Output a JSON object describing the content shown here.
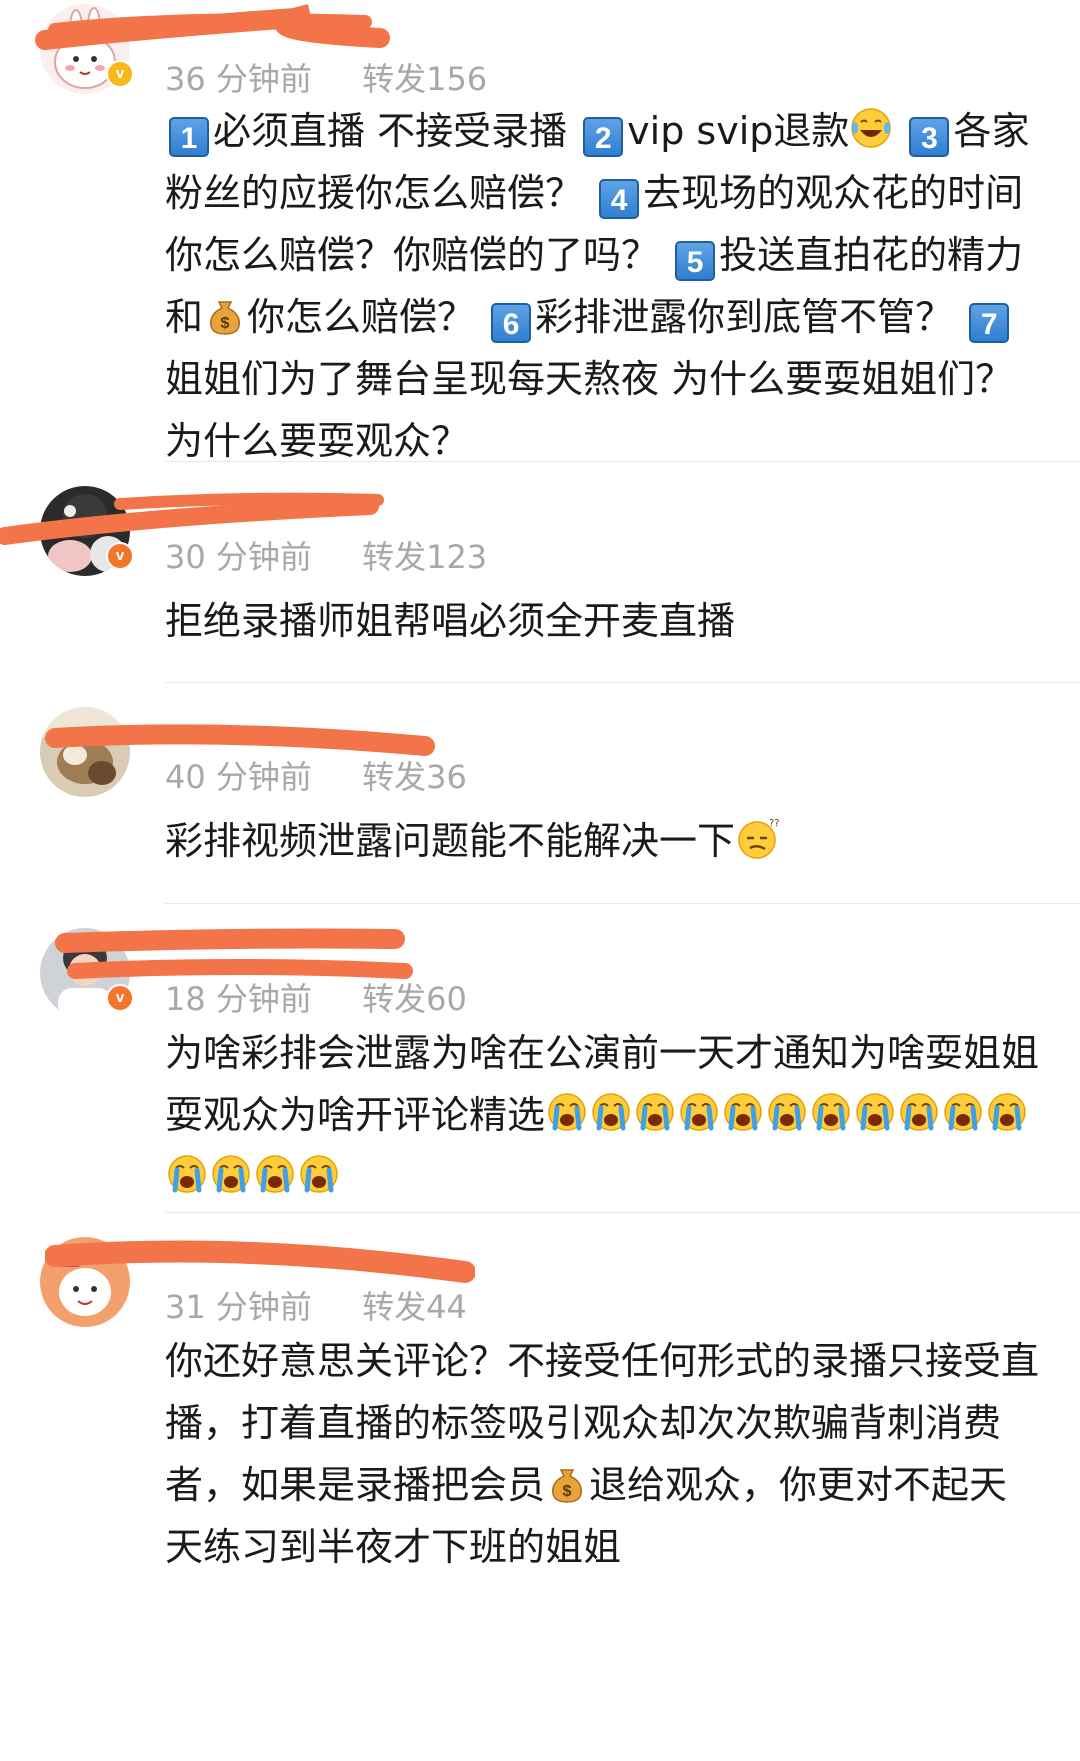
{
  "colors": {
    "redaction": "#f37448",
    "meta": "#a8a8a8",
    "text": "#1a1a1a",
    "badge_gold": "#f6b81b",
    "badge_orange": "#f2752b"
  },
  "comments": [
    {
      "time": "36 分钟前",
      "reposts": "转发156",
      "badge": "v",
      "segments": [
        {
          "t": "k",
          "v": "1"
        },
        {
          "t": "s",
          "v": "必须直播 不接受录播 "
        },
        {
          "t": "k",
          "v": "2"
        },
        {
          "t": "s",
          "v": "vip svip退款"
        },
        {
          "t": "e",
          "v": "laugh-cry-emoji"
        },
        {
          "t": "s",
          "v": " "
        },
        {
          "t": "k",
          "v": "3"
        },
        {
          "t": "s",
          "v": "各家粉丝的应援你怎么赔偿？ "
        },
        {
          "t": "k",
          "v": "4"
        },
        {
          "t": "s",
          "v": "去现场的观众花的时间你怎么赔偿？你赔偿的了吗？ "
        },
        {
          "t": "k",
          "v": "5"
        },
        {
          "t": "s",
          "v": "投送直拍花的精力和"
        },
        {
          "t": "e",
          "v": "money-bag-emoji"
        },
        {
          "t": "s",
          "v": "你怎么赔偿？ "
        },
        {
          "t": "k",
          "v": "6"
        },
        {
          "t": "s",
          "v": "彩排泄露你到底管不管？ "
        },
        {
          "t": "k",
          "v": "7"
        },
        {
          "t": "s",
          "v": "姐姐们为了舞台呈现每天熬夜 为什么要耍姐姐们？为什么要耍观众？"
        }
      ]
    },
    {
      "time": "30 分钟前",
      "reposts": "转发123",
      "badge": "v",
      "segments": [
        {
          "t": "s",
          "v": "拒绝录播师姐帮唱必须全开麦直播"
        }
      ]
    },
    {
      "time": "40 分钟前",
      "reposts": "转发36",
      "badge": "",
      "segments": [
        {
          "t": "s",
          "v": "彩排视频泄露问题能不能解决一下"
        },
        {
          "t": "e",
          "v": "confused-emoji"
        }
      ]
    },
    {
      "time": "18 分钟前",
      "reposts": "转发60",
      "badge": "v",
      "segments": [
        {
          "t": "s",
          "v": "为啥彩排会泄露为啥在公演前一天才通知为啥耍姐姐耍观众为啥开评论精选"
        },
        {
          "t": "e",
          "v": "crying-emoji"
        },
        {
          "t": "e",
          "v": "crying-emoji"
        },
        {
          "t": "e",
          "v": "crying-emoji"
        },
        {
          "t": "e",
          "v": "crying-emoji"
        },
        {
          "t": "e",
          "v": "crying-emoji"
        },
        {
          "t": "e",
          "v": "crying-emoji"
        },
        {
          "t": "e",
          "v": "crying-emoji"
        },
        {
          "t": "e",
          "v": "crying-emoji"
        },
        {
          "t": "e",
          "v": "crying-emoji"
        },
        {
          "t": "e",
          "v": "crying-emoji"
        },
        {
          "t": "e",
          "v": "crying-emoji"
        },
        {
          "t": "e",
          "v": "crying-emoji"
        },
        {
          "t": "e",
          "v": "crying-emoji"
        },
        {
          "t": "e",
          "v": "crying-emoji"
        },
        {
          "t": "e",
          "v": "crying-emoji"
        }
      ]
    },
    {
      "time": "31 分钟前",
      "reposts": "转发44",
      "badge": "",
      "segments": [
        {
          "t": "s",
          "v": "你还好意思关评论？不接受任何形式的录播只接受直播，打着直播的标签吸引观众却次次欺骗背刺消费者，如果是录播把会员"
        },
        {
          "t": "e",
          "v": "money-bag-emoji"
        },
        {
          "t": "s",
          "v": "退给观众，你更对不起天天练习到半夜才下班的姐姐"
        }
      ]
    }
  ]
}
